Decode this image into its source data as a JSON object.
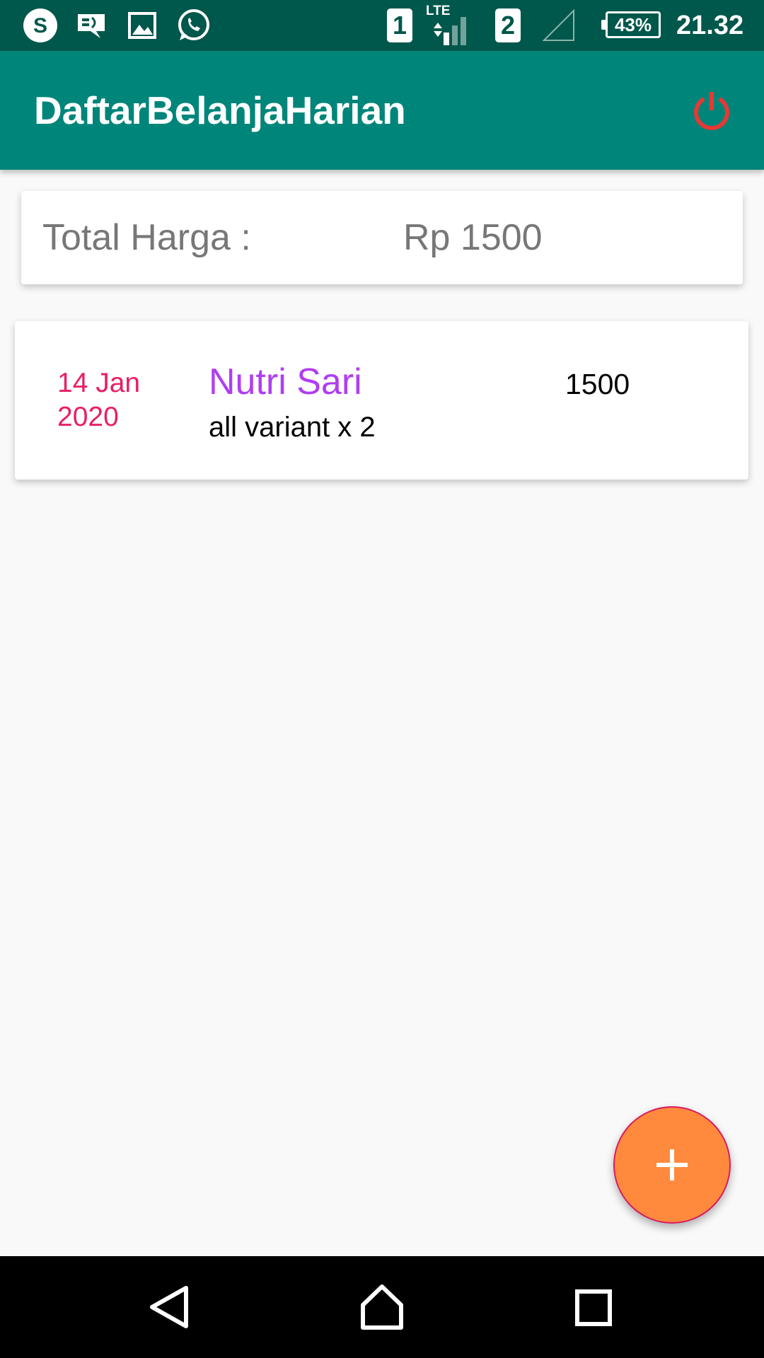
{
  "status_bar": {
    "icons": [
      "skype-icon",
      "message-icon",
      "image-icon",
      "whatsapp-icon"
    ],
    "sim1_label": "1",
    "network_type": "LTE",
    "sim2_label": "2",
    "battery_percent": "43%",
    "time": "21.32"
  },
  "app_bar": {
    "title": "DaftarBelanjaHarian",
    "power_icon_color": "#e53935"
  },
  "total": {
    "label": "Total Harga :",
    "value": "Rp 1500"
  },
  "items": [
    {
      "date_line1": "14 Jan",
      "date_line2": "2020",
      "name": "Nutri Sari",
      "description": "all variant x 2",
      "price": "1500"
    }
  ],
  "fab": {
    "icon": "plus-icon",
    "color": "#ff8a3d"
  },
  "nav_bar": {
    "icons": [
      "back-icon",
      "home-icon",
      "recents-icon"
    ]
  },
  "colors": {
    "status_bar": "#00574b",
    "app_bar": "#00857a",
    "date_text": "#e91e63",
    "item_name": "#b03ef0",
    "background": "#f9f9f9"
  }
}
